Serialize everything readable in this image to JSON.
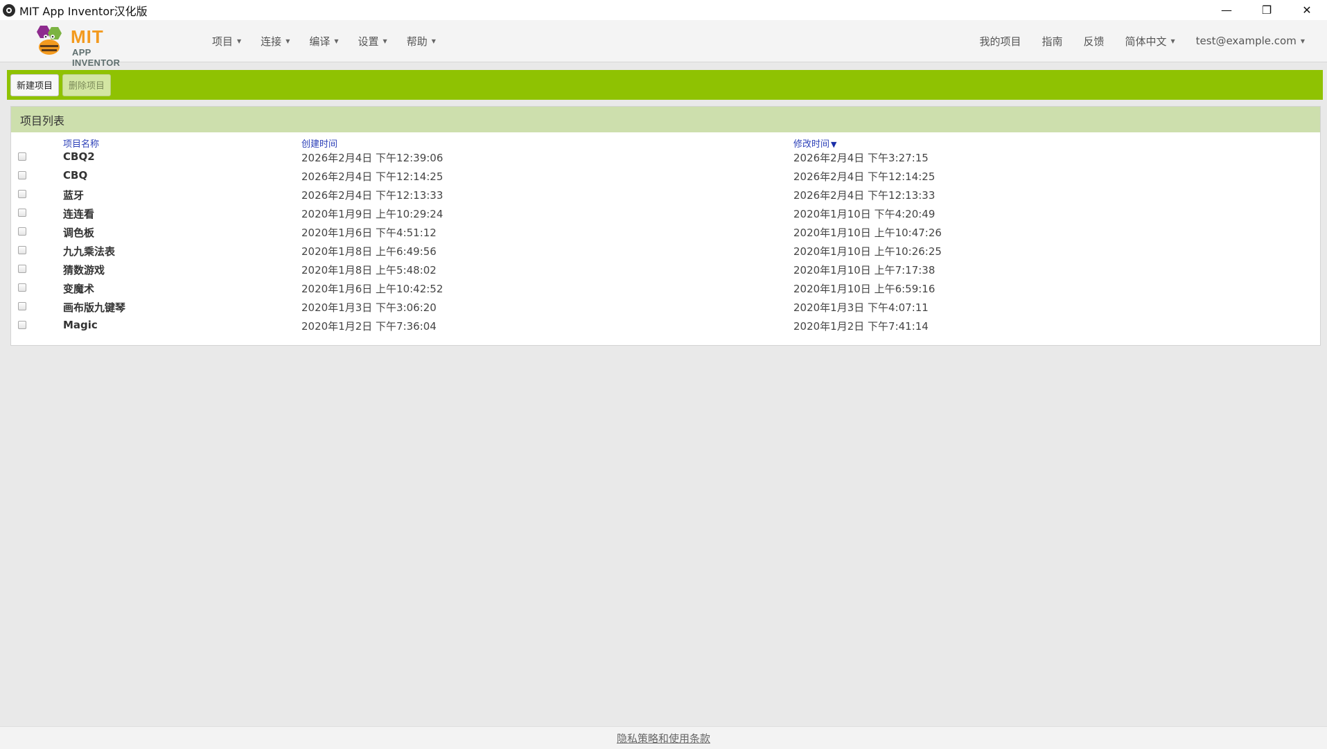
{
  "window": {
    "title": "MIT App Inventor汉化版",
    "minimize_icon": "—",
    "restore_icon": "❐",
    "close_icon": "✕"
  },
  "logo": {
    "main": "MIT",
    "sub": "APP INVENTOR"
  },
  "menu": {
    "items": [
      {
        "label": "项目"
      },
      {
        "label": "连接"
      },
      {
        "label": "编译"
      },
      {
        "label": "设置"
      },
      {
        "label": "帮助"
      }
    ]
  },
  "right_menu": {
    "my_projects": "我的项目",
    "guide": "指南",
    "feedback": "反馈",
    "language": "简体中文",
    "account": "test@example.com"
  },
  "toolbar": {
    "new_project": "新建项目",
    "delete_project": "删除项目"
  },
  "panel": {
    "title": "项目列表",
    "columns": {
      "name": "项目名称",
      "created": "创建时间",
      "modified": "修改时间"
    },
    "sort_indicator": "▼",
    "rows": [
      {
        "name": "CBQ2",
        "created": "2026年2月4日 下午12:39:06",
        "modified": "2026年2月4日 下午3:27:15"
      },
      {
        "name": "CBQ",
        "created": "2026年2月4日 下午12:14:25",
        "modified": "2026年2月4日 下午12:14:25"
      },
      {
        "name": "蓝牙",
        "created": "2026年2月4日 下午12:13:33",
        "modified": "2026年2月4日 下午12:13:33"
      },
      {
        "name": "连连看",
        "created": "2020年1月9日 上午10:29:24",
        "modified": "2020年1月10日 下午4:20:49"
      },
      {
        "name": "调色板",
        "created": "2020年1月6日 下午4:51:12",
        "modified": "2020年1月10日 上午10:47:26"
      },
      {
        "name": "九九乘法表",
        "created": "2020年1月8日 上午6:49:56",
        "modified": "2020年1月10日 上午10:26:25"
      },
      {
        "name": "猜数游戏",
        "created": "2020年1月8日 上午5:48:02",
        "modified": "2020年1月10日 上午7:17:38"
      },
      {
        "name": "变魔术",
        "created": "2020年1月6日 上午10:42:52",
        "modified": "2020年1月10日 上午6:59:16"
      },
      {
        "name": "画布版九键琴",
        "created": "2020年1月3日 下午3:06:20",
        "modified": "2020年1月3日 下午4:07:11"
      },
      {
        "name": "Magic",
        "created": "2020年1月2日 下午7:36:04",
        "modified": "2020年1月2日 下午7:41:14"
      }
    ]
  },
  "footer": {
    "privacy": "隐私策略和使用条款"
  },
  "colors": {
    "toolbar_green": "#8fc202",
    "panel_header": "#cddfad",
    "link_blue": "#2c40b8",
    "logo_orange": "#f39a1e"
  }
}
